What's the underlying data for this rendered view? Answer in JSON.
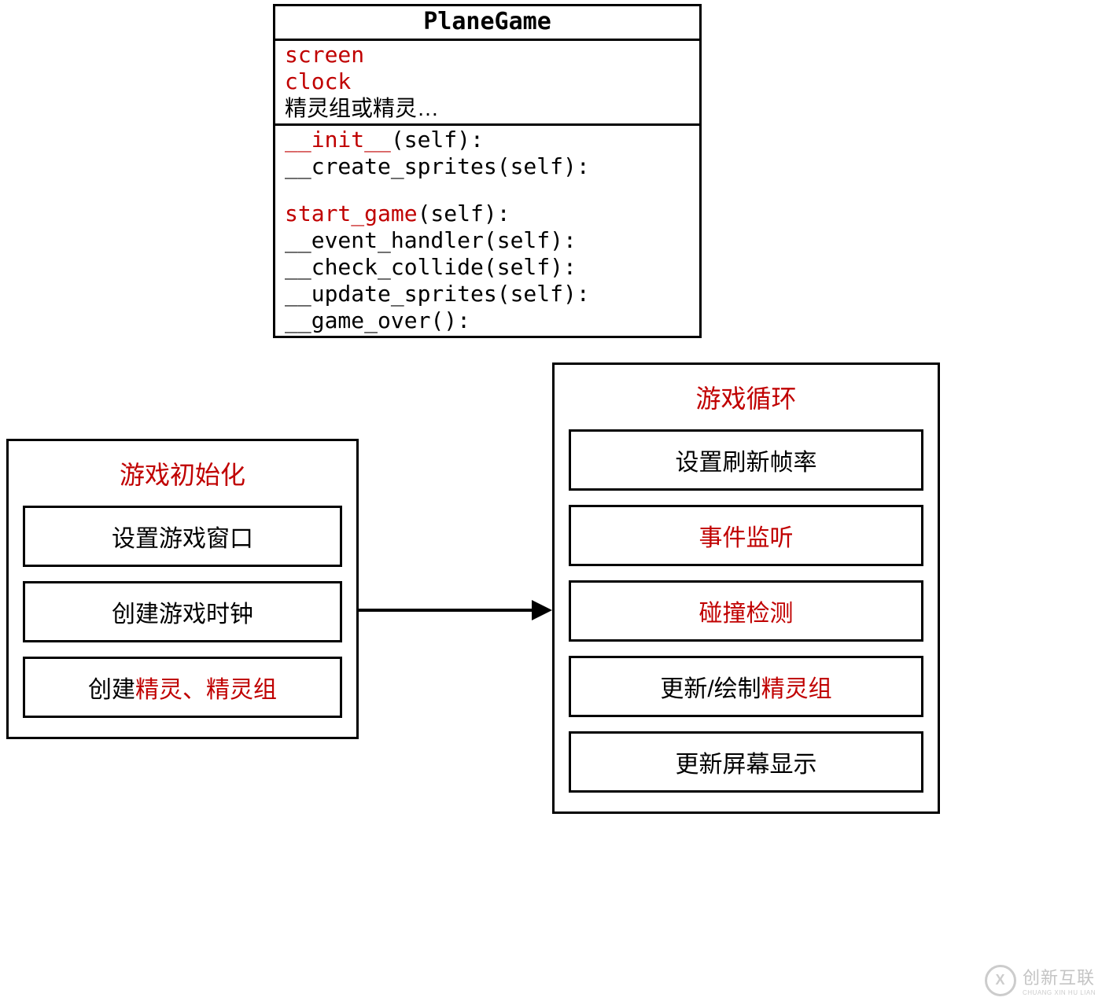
{
  "colors": {
    "accent_red": "#c00000",
    "border": "#000000",
    "background": "#ffffff"
  },
  "uml": {
    "class_name": "PlaneGame",
    "attrs": [
      {
        "segments": [
          {
            "text": "screen",
            "red": true
          }
        ]
      },
      {
        "segments": [
          {
            "text": "clock",
            "red": true
          }
        ]
      },
      {
        "segments": [
          {
            "text": "精灵组或精灵…",
            "red": false
          }
        ]
      }
    ],
    "methods_block1": [
      {
        "segments": [
          {
            "text": "__init__",
            "red": true
          },
          {
            "text": "(self):",
            "red": false
          }
        ]
      },
      {
        "segments": [
          {
            "text": "__create_sprites(self):",
            "red": false
          }
        ]
      }
    ],
    "methods_block2": [
      {
        "segments": [
          {
            "text": "start_game",
            "red": true
          },
          {
            "text": "(self):",
            "red": false
          }
        ]
      },
      {
        "segments": [
          {
            "text": "__event_handler(self):",
            "red": false
          }
        ]
      },
      {
        "segments": [
          {
            "text": "__check_collide(self):",
            "red": false
          }
        ]
      },
      {
        "segments": [
          {
            "text": "__update_sprites(self):",
            "red": false
          }
        ]
      },
      {
        "segments": [
          {
            "text": "__game_over():",
            "red": false
          }
        ]
      }
    ]
  },
  "init_panel": {
    "title": "游戏初始化",
    "steps": [
      {
        "segments": [
          {
            "text": "设置游戏窗口",
            "red": false
          }
        ]
      },
      {
        "segments": [
          {
            "text": "创建游戏时钟",
            "red": false
          }
        ]
      },
      {
        "segments": [
          {
            "text": "创建",
            "red": false
          },
          {
            "text": "精灵、精灵组",
            "red": true
          }
        ]
      }
    ]
  },
  "loop_panel": {
    "title": "游戏循环",
    "steps": [
      {
        "segments": [
          {
            "text": "设置刷新帧率",
            "red": false
          }
        ]
      },
      {
        "segments": [
          {
            "text": "事件监听",
            "red": true
          }
        ]
      },
      {
        "segments": [
          {
            "text": "碰撞检测",
            "red": true
          }
        ]
      },
      {
        "segments": [
          {
            "text": "更新/绘制",
            "red": false
          },
          {
            "text": "精灵组",
            "red": true
          }
        ]
      },
      {
        "segments": [
          {
            "text": "更新屏幕显示",
            "red": false
          }
        ]
      }
    ]
  },
  "watermark": {
    "logo_text": "X",
    "main": "创新互联",
    "sub": "CHUANG XIN HU LIAN"
  }
}
